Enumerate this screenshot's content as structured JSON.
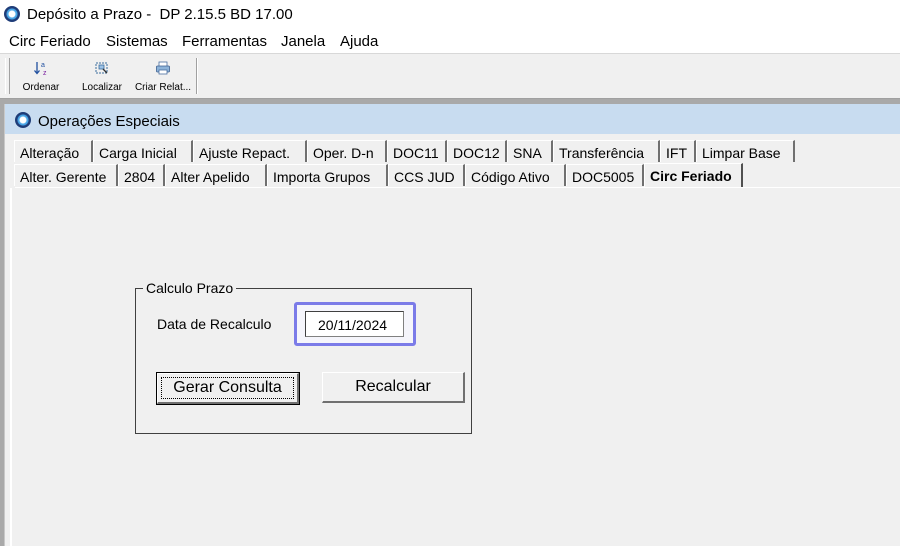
{
  "window": {
    "title": "Depósito a Prazo -  DP 2.15.5 BD 17.00"
  },
  "menu": [
    "Circ Feriado",
    "Sistemas",
    "Ferramentas",
    "Janela",
    "Ajuda"
  ],
  "toolbar": {
    "ordenar": "Ordenar",
    "localizar": "Localizar",
    "criar_relat": "Criar Relat..."
  },
  "child_window": {
    "title": "Operações Especiais"
  },
  "tabs_row1": [
    "Alteração",
    "Carga Inicial",
    "Ajuste Repact.",
    "Oper. D-n",
    "DOC11",
    "DOC12",
    "SNA",
    "Transferência",
    "IFT",
    "Limpar Base"
  ],
  "tabs_row2": [
    "Alter. Gerente",
    "2804",
    "Alter Apelido",
    "Importa Grupos",
    "CCS JUD",
    "Código Ativo",
    "DOC5005",
    "Circ Feriado"
  ],
  "active_tab": "Circ Feriado",
  "group": {
    "title": "Calculo Prazo",
    "date_label": "Data de Recalculo",
    "date_value": "20/11/2024",
    "gerar_button": "Gerar Consulta",
    "recalcular_button": "Recalcular"
  },
  "colors": {
    "focus_highlight": "#7b7be8",
    "child_title_bg": "#c8dcf0",
    "mdi_bg": "#a9a9a9"
  }
}
